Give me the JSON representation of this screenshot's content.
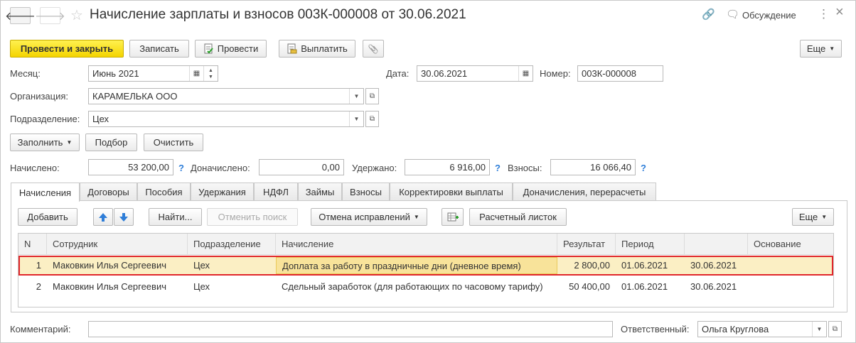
{
  "header": {
    "title": "Начисление зарплаты и взносов 003К-000008 от 30.06.2021",
    "discussion_label": "Обсуждение",
    "menu_icon": "⋮",
    "close_icon": "×",
    "back_icon": "🡐",
    "forward_icon": "🡒",
    "star_icon": "☆",
    "link_icon": "🔗",
    "discussion_icon": "🗨"
  },
  "toolbar": {
    "post_close": "Провести и закрыть",
    "save": "Записать",
    "post": "Провести",
    "pay": "Выплатить",
    "attach_icon": "📎",
    "more": "Еще"
  },
  "form": {
    "month_label": "Месяц:",
    "month_value": "Июнь 2021",
    "date_label": "Дата:",
    "date_value": "30.06.2021",
    "number_label": "Номер:",
    "number_value": "003К-000008",
    "org_label": "Организация:",
    "org_value": "КАРАМЕЛЬКА ООО",
    "dept_label": "Подразделение:",
    "dept_value": "Цех"
  },
  "actions": {
    "fill": "Заполнить",
    "pick": "Подбор",
    "clear": "Очистить"
  },
  "totals": {
    "accrued_label": "Начислено:",
    "accrued_value": "53 200,00",
    "extra_label": "Доначислено:",
    "extra_value": "0,00",
    "withheld_label": "Удержано:",
    "withheld_value": "6 916,00",
    "contrib_label": "Взносы:",
    "contrib_value": "16 066,40",
    "help": "?"
  },
  "tabs": [
    "Начисления",
    "Договоры",
    "Пособия",
    "Удержания",
    "НДФЛ",
    "Займы",
    "Взносы",
    "Корректировки выплаты",
    "Доначисления, перерасчеты"
  ],
  "table_toolbar": {
    "add": "Добавить",
    "find": "Найти...",
    "cancel_search": "Отменить поиск",
    "cancel_corrections": "Отмена исправлений",
    "payslip": "Расчетный листок",
    "more": "Еще"
  },
  "table": {
    "columns": [
      "N",
      "Сотрудник",
      "Подразделение",
      "Начисление",
      "Результат",
      "Период",
      "",
      "Основание"
    ],
    "rows": [
      {
        "n": "1",
        "employee": "Маковкин Илья Сергеевич",
        "dept": "Цех",
        "accrual": "Доплата за работу в праздничные дни (дневное время)",
        "result": "2 800,00",
        "from": "01.06.2021",
        "to": "30.06.2021",
        "basis": ""
      },
      {
        "n": "2",
        "employee": "Маковкин Илья Сергеевич",
        "dept": "Цех",
        "accrual": "Сдельный заработок (для работающих по часовому тарифу)",
        "result": "50 400,00",
        "from": "01.06.2021",
        "to": "30.06.2021",
        "basis": ""
      }
    ]
  },
  "footer": {
    "comment_label": "Комментарий:",
    "comment_value": "",
    "responsible_label": "Ответственный:",
    "responsible_value": "Ольга Круглова"
  },
  "colors": {
    "primary_button": "#f4d400",
    "selected_row": "#fbefc4",
    "selection_outline": "#e0262a",
    "arrow_blue": "#2f7ed8"
  }
}
